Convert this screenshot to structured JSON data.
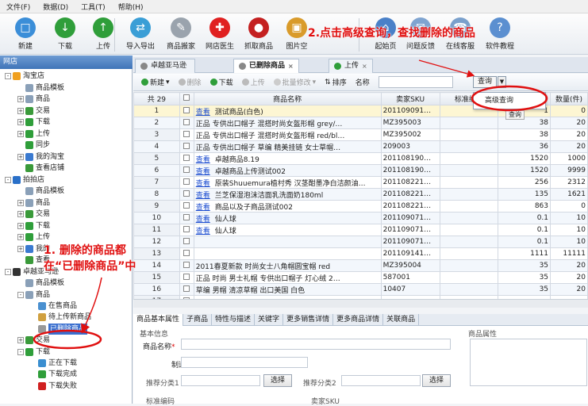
{
  "menu": [
    "文件(F)",
    "数据(D)",
    "工具(T)",
    "帮助(H)"
  ],
  "toolbar": [
    {
      "label": "新建",
      "icon": "new-file-icon",
      "color": "#3b8ed8"
    },
    {
      "label": "下载",
      "icon": "download-icon",
      "color": "#2f9e3a"
    },
    {
      "label": "上传",
      "icon": "upload-icon",
      "color": "#2f9e3a"
    },
    {
      "label": "导入导出",
      "icon": "import-export-icon",
      "color": "#3a9ed6"
    },
    {
      "label": "商品搬家",
      "icon": "move-goods-icon",
      "color": "#9aa3ad"
    },
    {
      "label": "网店医生",
      "icon": "red-cross-icon",
      "color": "#e02020"
    },
    {
      "label": "抓取商品",
      "icon": "spiderman-icon",
      "color": "#c42020"
    },
    {
      "label": "图片空",
      "icon": "picture-icon",
      "color": "#d99b2b"
    },
    {
      "label": "起始页",
      "icon": "home-page-icon",
      "color": "#4a80c8"
    },
    {
      "label": "问题反馈",
      "icon": "feedback-icon",
      "color": "#7fa4d0"
    },
    {
      "label": "在线客服",
      "icon": "online-service-icon",
      "color": "#7aa0cc"
    },
    {
      "label": "软件教程",
      "icon": "tutorial-icon",
      "color": "#5b8fd0"
    }
  ],
  "sidebar": {
    "title": "网店",
    "tree": [
      {
        "label": "淘宝店",
        "level": 0,
        "exp": "-",
        "c": "#f0a020"
      },
      {
        "label": "商品模板",
        "level": 1,
        "exp": "",
        "c": "#8aa0b8"
      },
      {
        "label": "商品",
        "level": 1,
        "exp": "+",
        "c": "#8aa0b8"
      },
      {
        "label": "交易",
        "level": 1,
        "exp": "+",
        "c": "#3a9a3a"
      },
      {
        "label": "下载",
        "level": 1,
        "exp": "+",
        "c": "#2f9e3a"
      },
      {
        "label": "上传",
        "level": 1,
        "exp": "+",
        "c": "#2f9e3a"
      },
      {
        "label": "同步",
        "level": 1,
        "exp": "",
        "c": "#2f9e3a"
      },
      {
        "label": "我的淘宝",
        "level": 1,
        "exp": "+",
        "c": "#3a7ad0"
      },
      {
        "label": "查看店铺",
        "level": 1,
        "exp": "",
        "c": "#3a9a3a"
      },
      {
        "label": "拍拍店",
        "level": 0,
        "exp": "-",
        "c": "#2a70c8"
      },
      {
        "label": "商品模板",
        "level": 1,
        "exp": "",
        "c": "#8aa0b8"
      },
      {
        "label": "商品",
        "level": 1,
        "exp": "+",
        "c": "#8aa0b8"
      },
      {
        "label": "交易",
        "level": 1,
        "exp": "+",
        "c": "#3a9a3a"
      },
      {
        "label": "下载",
        "level": 1,
        "exp": "+",
        "c": "#2f9e3a"
      },
      {
        "label": "上传",
        "level": 1,
        "exp": "+",
        "c": "#2f9e3a"
      },
      {
        "label": "我的",
        "level": 1,
        "exp": "+",
        "c": "#3a7ad0"
      },
      {
        "label": "查看",
        "level": 1,
        "exp": "",
        "c": "#3a9a3a"
      },
      {
        "label": "卓越亚马逊",
        "level": 0,
        "exp": "-",
        "c": "#333"
      },
      {
        "label": "商品模板",
        "level": 1,
        "exp": "",
        "c": "#8aa0b8"
      },
      {
        "label": "商品",
        "level": 1,
        "exp": "-",
        "c": "#8aa0b8"
      },
      {
        "label": "在售商品",
        "level": 2,
        "exp": "",
        "c": "#4a90d0"
      },
      {
        "label": "待上传新商品",
        "level": 2,
        "exp": "",
        "c": "#d0a040"
      },
      {
        "label": "已删除商品",
        "level": 2,
        "exp": "",
        "c": "#999",
        "selected": true
      },
      {
        "label": "交易",
        "level": 1,
        "exp": "+",
        "c": "#3a9a3a"
      },
      {
        "label": "下载",
        "level": 1,
        "exp": "-",
        "c": "#2f9e3a"
      },
      {
        "label": "正在下载",
        "level": 2,
        "exp": "",
        "c": "#3a8ed0"
      },
      {
        "label": "下载完成",
        "level": 2,
        "exp": "",
        "c": "#2f9e3a"
      },
      {
        "label": "下载失败",
        "level": 2,
        "exp": "",
        "c": "#d02020"
      }
    ]
  },
  "tabs": [
    {
      "label": "卓越亚马逊",
      "close": "",
      "active": false
    },
    {
      "label": "已删除商品",
      "close": "×",
      "active": true
    },
    {
      "label": "上传",
      "close": "×",
      "active": false
    }
  ],
  "grid_toolbar": {
    "new": "新建",
    "delete": "删除",
    "download": "下载",
    "upload": "上传",
    "batch": "批量修改",
    "sort": "排序",
    "name_label": "名称",
    "query": "查询",
    "advanced_query": "高级查询",
    "query_small": "查询"
  },
  "grid": {
    "total": "共 29",
    "columns": [
      "",
      "",
      "商品名称",
      "卖家SKU",
      "标准编码",
      "",
      "数量(件)"
    ],
    "rows": [
      {
        "n": "1",
        "link": "查看",
        "name": "测试商品(白色)",
        "sku": "201109091…",
        "price": "1",
        "qty": "0",
        "cur": true
      },
      {
        "n": "2",
        "link": "",
        "name": "正品 专供出口帽子 混搭时尚女盔形帽 grey/…",
        "sku": "MZ395003",
        "price": "38",
        "qty": "20"
      },
      {
        "n": "3",
        "link": "",
        "name": "正品 专供出口帽子 混搭时尚女盔形帽 red/bl…",
        "sku": "MZ395002",
        "price": "38",
        "qty": "20"
      },
      {
        "n": "4",
        "link": "",
        "name": "正品 专供出口帽子 草编 精美挂链 女士草帽…",
        "sku": "209003",
        "price": "36",
        "qty": "20"
      },
      {
        "n": "5",
        "link": "查看",
        "name": "卓越商品8.19",
        "sku": "201108190…",
        "price": "1520",
        "qty": "1000"
      },
      {
        "n": "6",
        "link": "查看",
        "name": "卓越商品上传测试002",
        "sku": "201108190…",
        "price": "1520",
        "qty": "9999"
      },
      {
        "n": "7",
        "link": "查看",
        "name": "原装Shuuemura植村秀 汉茎酣墨净白洁颜油…",
        "sku": "201108221…",
        "price": "256",
        "qty": "2312"
      },
      {
        "n": "8",
        "link": "查看",
        "name": "兰芝保湿泡沫洁面乳洗面奶180ml",
        "sku": "201108221…",
        "price": "135",
        "qty": "1621"
      },
      {
        "n": "9",
        "link": "查看",
        "name": "商品以及子商品测试002",
        "sku": "201108221…",
        "price": "863",
        "qty": "0"
      },
      {
        "n": "10",
        "link": "查看",
        "name": "仙人球",
        "sku": "201109071…",
        "price": "0.1",
        "qty": "10"
      },
      {
        "n": "11",
        "link": "查看",
        "name": "仙人球",
        "sku": "201109071…",
        "price": "0.1",
        "qty": "10"
      },
      {
        "n": "12",
        "link": "",
        "name": "",
        "sku": "201109071…",
        "price": "0.1",
        "qty": "10"
      },
      {
        "n": "13",
        "link": "",
        "name": "",
        "sku": "201109141…",
        "price": "1111",
        "qty": "11111"
      },
      {
        "n": "14",
        "link": "",
        "name": "2011春夏新款 时尚女士八角帽圆宝帽 red",
        "sku": "MZ395004",
        "price": "35",
        "qty": "20"
      },
      {
        "n": "15",
        "link": "",
        "name": "正品 时尚 男士礼帽 专供出口帽子 灯心绒 2…",
        "sku": "587001",
        "price": "35",
        "qty": "20"
      },
      {
        "n": "16",
        "link": "",
        "name": "草编 男帽 清凉草帽 出口美国 白色",
        "sku": "10407",
        "price": "35",
        "qty": "20"
      },
      {
        "n": "17",
        "link": "",
        "name": "",
        "sku": "",
        "price": "",
        "qty": ""
      }
    ]
  },
  "bottom_tabs": [
    "商品基本属性",
    "子商品",
    "特性与描述",
    "关键字",
    "更多销售详情",
    "更多商品详情",
    "关联商品"
  ],
  "form": {
    "section": "基本信息",
    "name": "商品名称",
    "maker": "制造商",
    "cat1": "推荐分类1",
    "cat2": "推荐分类2",
    "choose": "选择",
    "code": "标准编码",
    "sku": "卖家SKU",
    "attr": "商品属性",
    "star": "*"
  },
  "annotations": {
    "step1": "1. 删除的商品都在“已删除商品”中",
    "step2": "2.点击高级查询，查找删除的商品",
    "color": "#e01010"
  }
}
